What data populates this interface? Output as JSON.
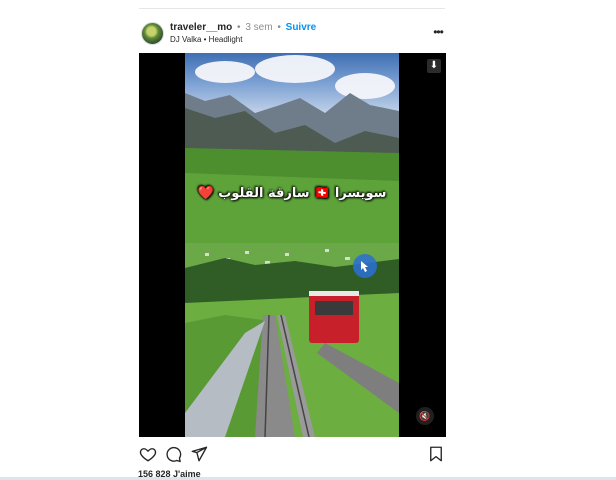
{
  "post": {
    "username": "traveler__mo",
    "separator": "•",
    "time": "3 sem",
    "follow_label": "Suivre",
    "audio": "DJ Valka • Headlight",
    "more_icon": "more-horizontal-icon",
    "likes": "156 828 J'aime"
  },
  "media": {
    "overlay_text": "سويسرا 🇨🇭 سارقة القلوب ❤️",
    "save_icon": "download-icon",
    "mute_icon": "speaker-muted-icon"
  },
  "actions": {
    "like_icon": "heart-icon",
    "comment_icon": "comment-icon",
    "share_icon": "send-icon",
    "save_icon": "bookmark-icon"
  }
}
